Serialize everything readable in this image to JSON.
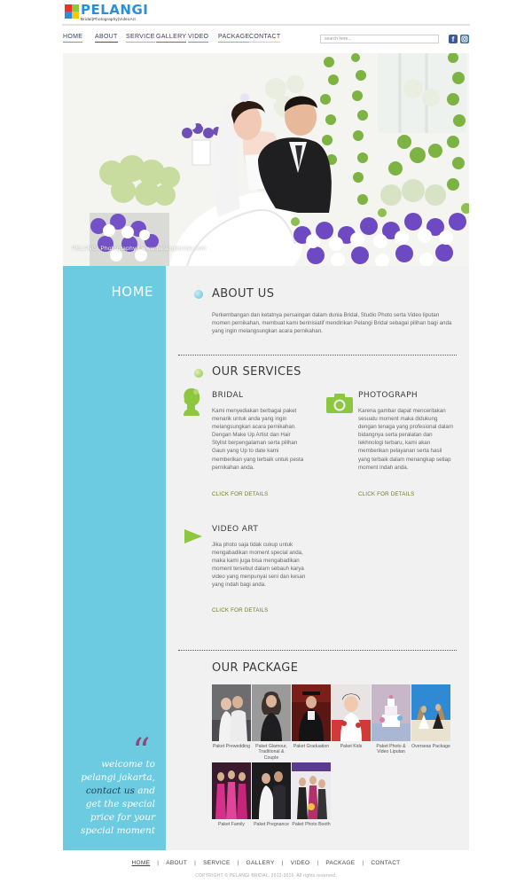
{
  "brand": {
    "name": "PELANGI",
    "tagline": "Bridal|Photography|VideoArt",
    "colors": [
      "#e8322c",
      "#8dc63f",
      "#2a8fd6",
      "#f5c518"
    ]
  },
  "nav": {
    "items": [
      {
        "label": "HOME",
        "color": "#4aa3df"
      },
      {
        "label": "ABOUT",
        "color": "#7c2f8c"
      },
      {
        "label": "SERVICE",
        "color": "#f5a623"
      },
      {
        "label": "GALLERY",
        "color": "#d64545"
      },
      {
        "label": "VIDEO",
        "color": "#3db0c8"
      },
      {
        "label": "PACKAGE",
        "color": "#8dc63f"
      },
      {
        "label": "CONTACT",
        "color": "#f0d83a"
      }
    ],
    "search_placeholder": "search here...",
    "social": [
      "facebook-icon",
      "instagram-icon"
    ]
  },
  "hero": {
    "caption": "PELANGI Photography | www.pelangibridal.com"
  },
  "sidebar": {
    "title": "HOME",
    "quote_mark": "“",
    "welcome_before": "welcome to pelangi jakarta,",
    "welcome_link": "contact us",
    "welcome_after": "and get the special price for your special moment"
  },
  "about": {
    "title": "ABOUT US",
    "text": "Perkembangan dan ketatnya persaingan dalam dunia Bridal, Studio Photo serta Video liputan momen pernikahan, membuat kami berinisiatif mendirikan Pelangi Bridal sebagai pilihan bagi anda yang ingin melangsungkan acara pernikahan."
  },
  "services": {
    "title": "OUR SERVICES",
    "items": [
      {
        "title": "BRIDAL",
        "icon": "bride-icon",
        "text": "Kami menyediakan berbagai paket menarik untuk anda yang ingin melangsungkan acara pernikahan. Dengan Make Up Artist dan Hair Stylist berpengalaman serta pilihan Gaun yang Up to date kami memberikan yang terbaik untuk pesta pernikahan anda.",
        "link": "CLICK FOR DETAILS"
      },
      {
        "title": "PHOTOGRAPH",
        "icon": "camera-icon",
        "text": "Karena gambar dapat menceritakan sesuatu moment maka didukung dengan tenaga yang profesional dalam bidangnya serta peralatan dan tekhnologi terbaru, kami akan memberikan pelayanan serta hasil yang terbaik dalam menangkap setiap moment indah anda.",
        "link": "CLICK FOR DETAILS"
      },
      {
        "title": "VIDEO ART",
        "icon": "play-icon",
        "text": "Jika photo saja tidak cukup untuk mengabadikan moment special anda, maka kami juga bisa mengabadikan moment tersebut dalam sebauh karya video yang menpunyai seni dan kesan yang indah bagi anda.",
        "link": "CLICK FOR DETAILS"
      }
    ]
  },
  "package": {
    "title": "OUR PACKAGE",
    "items": [
      {
        "label": "Paket Prewedding"
      },
      {
        "label": "Paket Glamour, Traditional & Couple"
      },
      {
        "label": "Paket Graduation"
      },
      {
        "label": "Paket Kids"
      },
      {
        "label": "Paket Photo & Video Liputan"
      },
      {
        "label": "Overseas Package"
      },
      {
        "label": "Paket Family"
      },
      {
        "label": "Paket Pregnance"
      },
      {
        "label": "Paket Photo Booth"
      }
    ]
  },
  "footer": {
    "links": [
      "HOME",
      "ABOUT",
      "SERVICE",
      "GALLERY",
      "VIDEO",
      "PACKAGE",
      "CONTACT"
    ],
    "separator": "|",
    "copyright": "COPYRIGHT © PELANGI BRIDAL. 2012-2016. All rights reserved."
  }
}
